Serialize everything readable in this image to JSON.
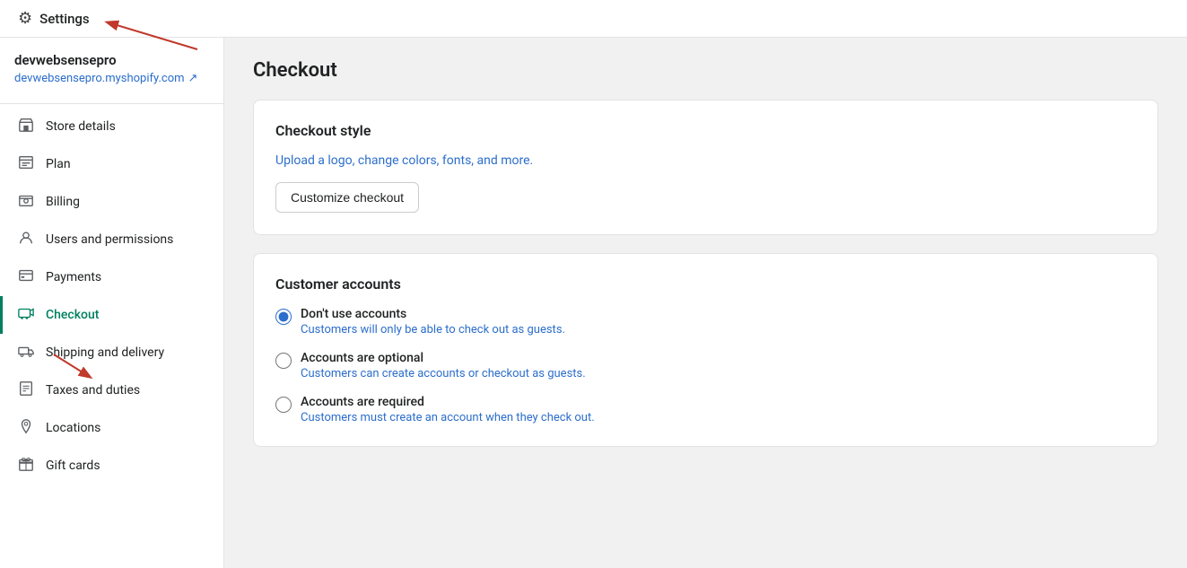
{
  "topbar": {
    "title": "Settings",
    "gear_icon": "⚙"
  },
  "sidebar": {
    "store_name": "devwebsensepro",
    "store_link": "devwebsensepro.myshopify.com",
    "items": [
      {
        "id": "store-details",
        "label": "Store details",
        "icon": "store"
      },
      {
        "id": "plan",
        "label": "Plan",
        "icon": "plan"
      },
      {
        "id": "billing",
        "label": "Billing",
        "icon": "billing"
      },
      {
        "id": "users-permissions",
        "label": "Users and permissions",
        "icon": "user"
      },
      {
        "id": "payments",
        "label": "Payments",
        "icon": "payments"
      },
      {
        "id": "checkout",
        "label": "Checkout",
        "icon": "checkout",
        "active": true
      },
      {
        "id": "shipping-delivery",
        "label": "Shipping and delivery",
        "icon": "shipping"
      },
      {
        "id": "taxes-duties",
        "label": "Taxes and duties",
        "icon": "taxes"
      },
      {
        "id": "locations",
        "label": "Locations",
        "icon": "locations"
      },
      {
        "id": "gift-cards",
        "label": "Gift cards",
        "icon": "giftcards"
      }
    ]
  },
  "page": {
    "title": "Checkout",
    "checkout_style_card": {
      "title": "Checkout style",
      "description": "Upload a logo, change colors, fonts, and more.",
      "button_label": "Customize checkout"
    },
    "customer_accounts_card": {
      "title": "Customer accounts",
      "options": [
        {
          "id": "no-accounts",
          "label": "Don't use accounts",
          "sublabel": "Customers will only be able to check out as guests.",
          "checked": true
        },
        {
          "id": "optional-accounts",
          "label": "Accounts are optional",
          "sublabel": "Customers can create accounts or checkout as guests.",
          "checked": false
        },
        {
          "id": "required-accounts",
          "label": "Accounts are required",
          "sublabel": "Customers must create an account when they check out.",
          "checked": false
        }
      ]
    }
  }
}
